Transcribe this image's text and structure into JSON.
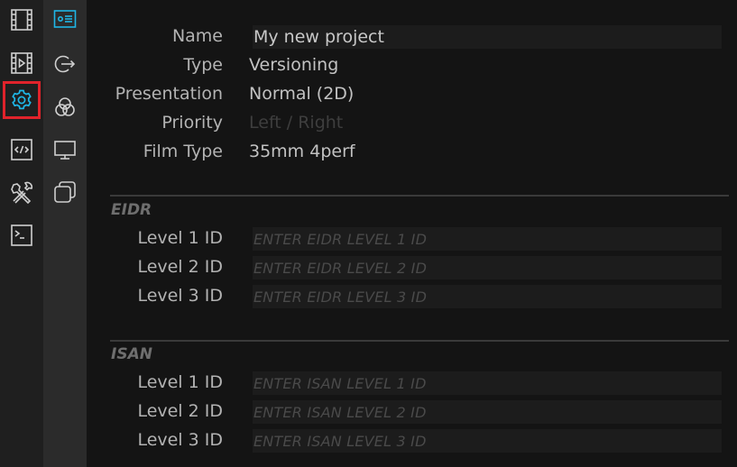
{
  "colors": {
    "accent": "#1fb6e6",
    "selection_border": "#e0232b"
  },
  "rail_primary": {
    "items": [
      {
        "icon": "filmstrip-icon"
      },
      {
        "icon": "film-play-icon"
      },
      {
        "icon": "gear-icon",
        "selected": true
      },
      {
        "icon": "code-icon"
      },
      {
        "icon": "tools-icon"
      },
      {
        "icon": "terminal-icon"
      }
    ]
  },
  "rail_secondary": {
    "items": [
      {
        "icon": "info-card-icon",
        "selected": true
      },
      {
        "icon": "export-icon"
      },
      {
        "icon": "color-circles-icon"
      },
      {
        "icon": "monitor-icon"
      },
      {
        "icon": "layers-icon"
      }
    ]
  },
  "project": {
    "name_label": "Name",
    "name_value": "My new project",
    "type_label": "Type",
    "type_value": "Versioning",
    "presentation_label": "Presentation",
    "presentation_value": "Normal (2D)",
    "priority_label": "Priority",
    "priority_value": "Left / Right",
    "film_type_label": "Film Type",
    "film_type_value": "35mm 4perf"
  },
  "eidr": {
    "title": "EIDR",
    "level1_label": "Level 1 ID",
    "level1_placeholder": "ENTER EIDR LEVEL 1 ID",
    "level2_label": "Level 2 ID",
    "level2_placeholder": "ENTER EIDR LEVEL 2 ID",
    "level3_label": "Level 3 ID",
    "level3_placeholder": "ENTER EIDR LEVEL 3 ID"
  },
  "isan": {
    "title": "ISAN",
    "level1_label": "Level 1 ID",
    "level1_placeholder": "ENTER ISAN LEVEL 1 ID",
    "level2_label": "Level 2 ID",
    "level2_placeholder": "ENTER ISAN LEVEL 2 ID",
    "level3_label": "Level 3 ID",
    "level3_placeholder": "ENTER ISAN LEVEL 3 ID"
  }
}
